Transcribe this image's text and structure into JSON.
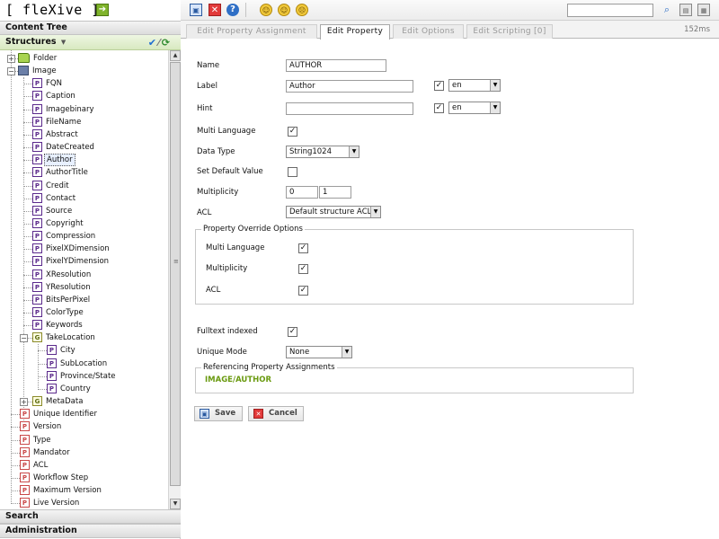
{
  "app": {
    "logo_text": "[ fleXive ]",
    "logo_arrow": "➔"
  },
  "left_panel": {
    "content_tree": "Content Tree",
    "structures": "Structures",
    "search": "Search",
    "administration": "Administration"
  },
  "icons": {
    "property": "P",
    "group": "G",
    "system_property": "P"
  },
  "tree": {
    "folder": "Folder",
    "image": "Image",
    "image_children": [
      "FQN",
      "Caption",
      "Imagebinary",
      "FileName",
      "Abstract",
      "DateCreated",
      "Author",
      "AuthorTitle",
      "Credit",
      "Contact",
      "Source",
      "Copyright",
      "Compression",
      "PixelXDimension",
      "PixelYDimension",
      "XResolution",
      "YResolution",
      "BitsPerPixel",
      "ColorType",
      "Keywords"
    ],
    "selected": "Author",
    "take_location": "TakeLocation",
    "take_location_children": [
      "City",
      "SubLocation",
      "Province/State",
      "Country"
    ],
    "metadata": "MetaData",
    "system_properties": [
      "Unique Identifier",
      "Version",
      "Type",
      "Mandator",
      "ACL",
      "Workflow Step",
      "Maximum Version",
      "Live Version"
    ]
  },
  "tabs": {
    "edit_property_assignment": "Edit Property Assignment",
    "edit_property": "Edit Property",
    "edit_options": "Edit Options",
    "edit_scripting": "Edit Scripting [0]",
    "active": "edit_property"
  },
  "timing": "152ms",
  "form": {
    "name_label": "Name",
    "name_value": "AUTHOR",
    "label_label": "Label",
    "label_value": "Author",
    "label_lang": "en",
    "label_lang_checked": true,
    "hint_label": "Hint",
    "hint_value": "",
    "hint_lang": "en",
    "hint_lang_checked": true,
    "multi_language_label": "Multi Language",
    "multi_language_checked": true,
    "data_type_label": "Data Type",
    "data_type_value": "String1024",
    "set_default_label": "Set Default Value",
    "set_default_checked": false,
    "multiplicity_label": "Multiplicity",
    "multiplicity_min": "0",
    "multiplicity_max": "1",
    "acl_label": "ACL",
    "acl_value": "Default structure ACL",
    "override_legend": "Property Override Options",
    "override_multi_language": "Multi Language",
    "override_multiplicity": "Multiplicity",
    "override_acl": "ACL",
    "fulltext_label": "Fulltext indexed",
    "fulltext_checked": true,
    "unique_mode_label": "Unique Mode",
    "unique_mode_value": "None",
    "referencing_legend": "Referencing Property Assignments",
    "referencing_value": "IMAGE/AUTHOR"
  },
  "buttons": {
    "save": "Save",
    "cancel": "Cancel"
  }
}
